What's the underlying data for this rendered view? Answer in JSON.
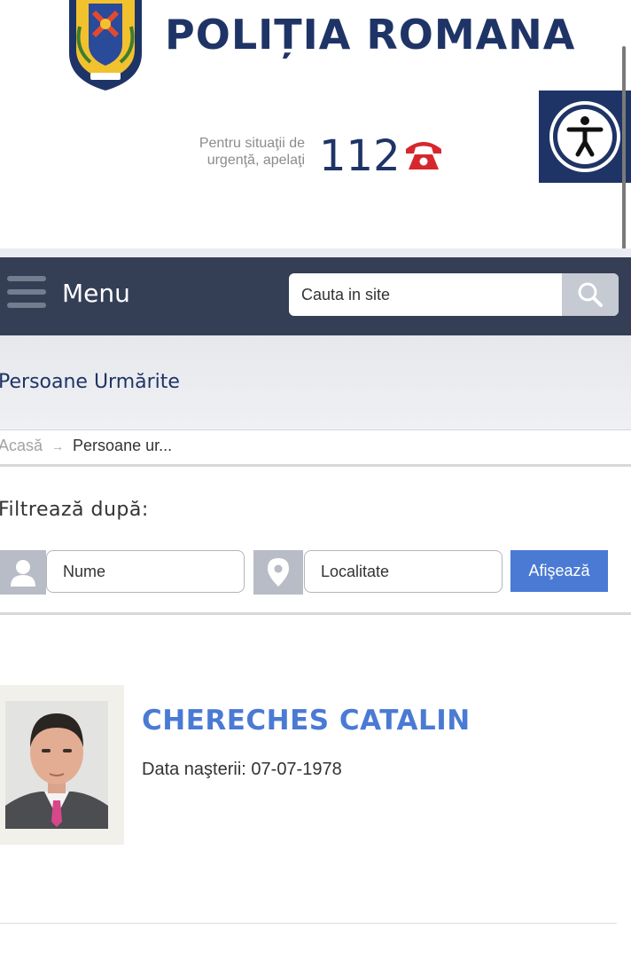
{
  "header": {
    "site_title": "POLIȚIA ROMANA",
    "emergency_text": "Pentru situaţii de urgenţă, apelaţi",
    "emergency_number": "112",
    "phone_icon": "phone-icon",
    "accessibility_icon": "accessibility-icon"
  },
  "nav": {
    "menu_label": "Menu",
    "search_placeholder": "Cauta in site",
    "search_icon": "search-icon"
  },
  "page": {
    "title": "Persoane Urmărite"
  },
  "breadcrumb": {
    "home": "Acasă",
    "current": "Persoane ur..."
  },
  "filter": {
    "label": "Filtrează după:",
    "name_placeholder": "Nume",
    "locality_placeholder": "Localitate",
    "submit_label": "Afişează"
  },
  "results": [
    {
      "name": "CHERECHES CATALIN",
      "dob_label": "Data naşterii:",
      "dob_value": "07-07-1978"
    }
  ],
  "colors": {
    "brand_navy": "#1f3466",
    "nav_bg": "#343f56",
    "accent_blue": "#4a7ad4",
    "emergency_red": "#d6282c"
  }
}
